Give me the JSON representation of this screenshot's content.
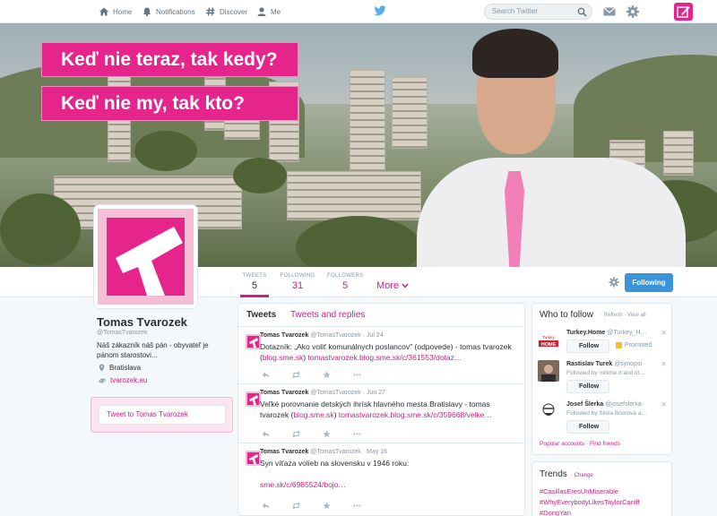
{
  "topbar": {
    "nav": [
      {
        "label": "Home",
        "icon": "home-icon"
      },
      {
        "label": "Notifications",
        "icon": "notifications-icon"
      },
      {
        "label": "Discover",
        "icon": "hashtag-icon"
      },
      {
        "label": "Me",
        "icon": "person-icon"
      }
    ],
    "search_placeholder": "Search Twitter"
  },
  "header": {
    "banner_line1": "Keď nie teraz, tak kedy?",
    "banner_line2": "Keď nie my, tak kto?"
  },
  "stats": [
    {
      "label": "TWEETS",
      "value": "5"
    },
    {
      "label": "FOLLOWING",
      "value": "31"
    },
    {
      "label": "FOLLOWERS",
      "value": "5"
    }
  ],
  "more_label": "More",
  "following_button": "Following",
  "profile": {
    "name": "Tomas Tvarozek",
    "handle": "@TomasTvarozek",
    "bio": "Náš zákazník náš pán - obyvateľ je pánom starostovi...",
    "location": "Bratislava",
    "website": "tvarozek.eu",
    "tweet_to": "Tweet to Tomas Tvarozek"
  },
  "timeline": {
    "tabs": [
      "Tweets",
      "Tweets and replies"
    ],
    "tweets": [
      {
        "name": "Tomas Tvarozek",
        "handle": "@TomasTvarozek",
        "date": "· Jul 24",
        "text_plain": "Dotazník: „Ako voliť komunálnych poslancov\" (odpovede) - tomas tvarozek (",
        "link1": "blog.sme.sk",
        "text_mid": ") ",
        "link2": "tomastvarozek.blog.sme.sk/c/361553/dotaz…"
      },
      {
        "name": "Tomas Tvarozek",
        "handle": "@TomasTvarozek",
        "date": "· Jun 27",
        "text_plain": "Veľké porovnanie detských ihrísk hlavného mesta Bratislavy - tomas tvarozek (",
        "link1": "blog.sme.sk",
        "text_mid": ") ",
        "link2": "tomastvarozek.blog.sme.sk/c/359668/velke…"
      },
      {
        "name": "Tomas Tvarozek",
        "handle": "@TomasTvarozek",
        "date": "· May 16",
        "text_plain": "Syn víťaza volieb na slovensku v 1946 roku:",
        "link2": "sme.sk/c/6985524/bojo…"
      }
    ]
  },
  "who_to_follow": {
    "title": "Who to follow",
    "links": "· Refresh · View all",
    "follow_label": "Follow",
    "promoted_label": "Promoted",
    "suggestions": [
      {
        "name": "Turkey.Home",
        "handle": "@Turkey_H…",
        "sub": ""
      },
      {
        "name": "Rastislav Turek",
        "handle": "@synopsi",
        "sub": "Followed by robime.it and ot…"
      },
      {
        "name": "Josef Šlerka",
        "handle": "@josefslerka",
        "sub": "Followed by Silvia Boorová a…"
      }
    ],
    "footer": "Popular accounts · Find friends"
  },
  "trends": {
    "title": "Trends",
    "change": "· Change",
    "items": [
      "#CasillasEresUnMiserable",
      "#WhyEverybodyLikesTaylorCaniff",
      "#DongYan"
    ]
  },
  "colors": {
    "accent": "#cc1f83",
    "brand_pink": "#e5258c",
    "follow_blue": "#3b94d9"
  }
}
